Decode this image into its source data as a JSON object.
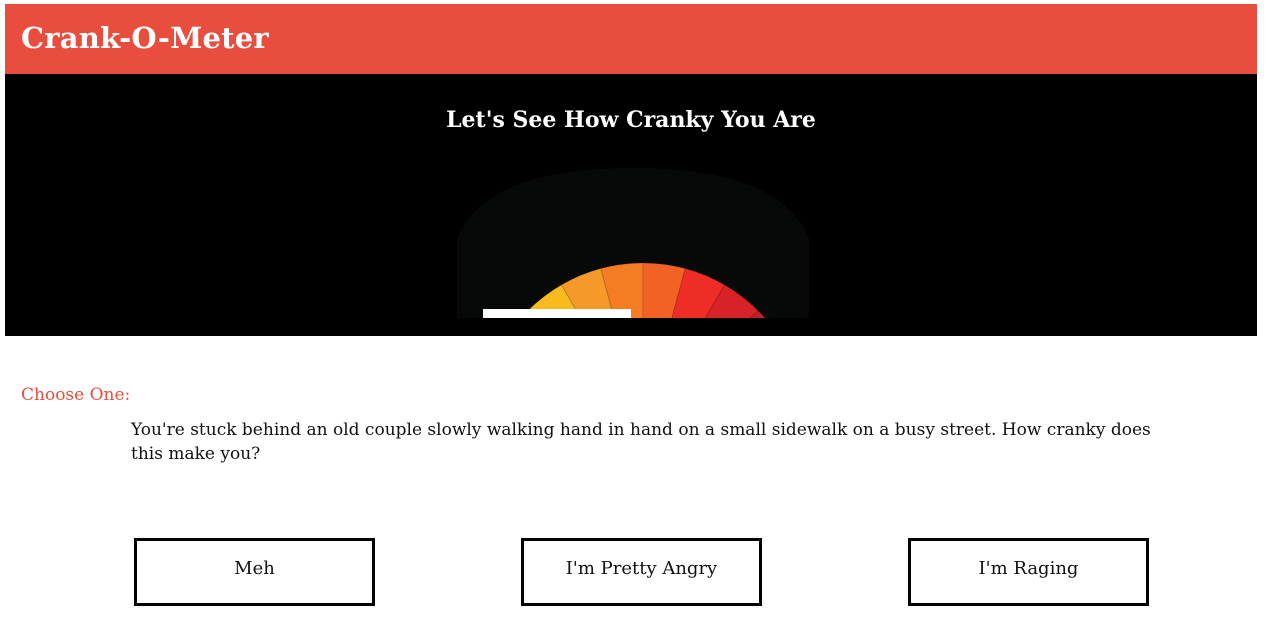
{
  "app": {
    "title": "Crank-O-Meter"
  },
  "hero": {
    "title": "Let's See How Cranky You Are",
    "gauge": {
      "level": 0,
      "segment_colors": [
        "#f9ec80",
        "#f8e72b",
        "#f9d31a",
        "#f9ba1f",
        "#f59a28",
        "#f57c23",
        "#f26224",
        "#ee2d26",
        "#d82227",
        "#c1202b",
        "#a81f24",
        "#931c1f"
      ],
      "background": "#070808"
    }
  },
  "quiz": {
    "prompt_label": "Choose One:",
    "question": "You're stuck behind an old couple slowly walking hand in hand on a small sidewalk on a busy street. How cranky does this make you?",
    "choices": [
      {
        "label": "Meh"
      },
      {
        "label": "I'm Pretty Angry"
      },
      {
        "label": "I'm Raging"
      }
    ]
  },
  "colors": {
    "accent": "#e84d3d",
    "hero_background": "#000000"
  }
}
